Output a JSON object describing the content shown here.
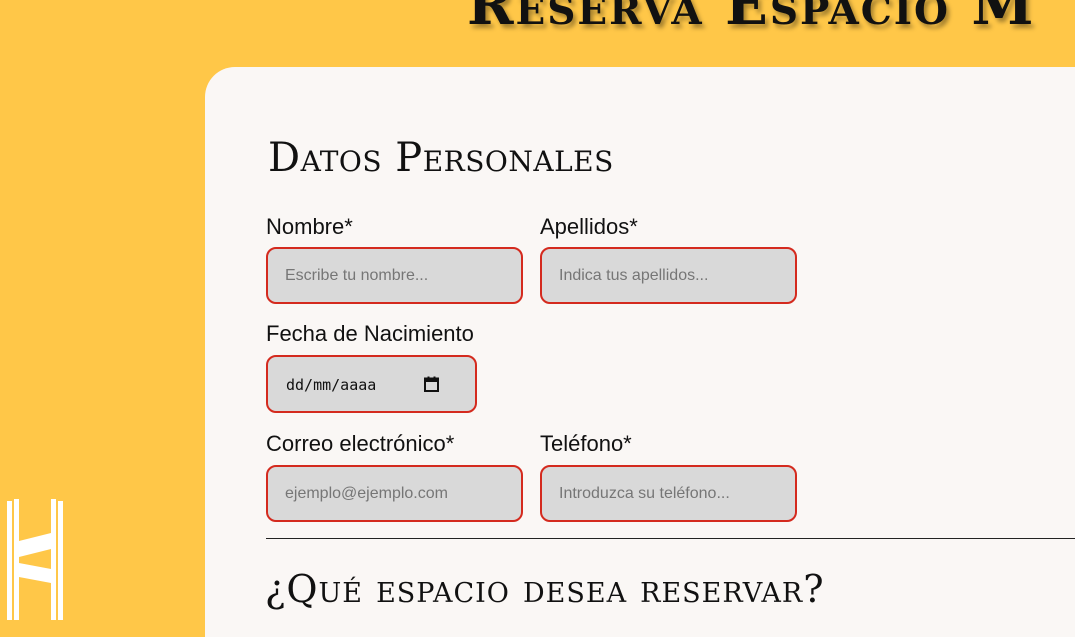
{
  "page": {
    "heading": "Reserva Espacio M"
  },
  "form": {
    "personal_section_title": "Datos Personales",
    "fields": {
      "nombre": {
        "label": "Nombre*",
        "placeholder": "Escribe tu nombre..."
      },
      "apellidos": {
        "label": "Apellidos*",
        "placeholder": "Indica tus apellidos..."
      },
      "fecha_nacimiento": {
        "label": "Fecha de Nacimiento",
        "value_placeholder": "dd/mm/aaaa"
      },
      "correo": {
        "label": "Correo electrónico*",
        "placeholder": "ejemplo@ejemplo.com"
      },
      "telefono": {
        "label": "Teléfono*",
        "placeholder": "Introduzca su teléfono..."
      }
    },
    "space_section_title": "¿Qué espacio desea reservar?"
  },
  "colors": {
    "background": "#FFC748",
    "card": "#FAF7F5",
    "input_fill": "#D9D9D9",
    "input_border": "#D42A1E"
  },
  "icons": {
    "logo": "hh-logo-icon",
    "date_picker": "calendar-icon"
  }
}
